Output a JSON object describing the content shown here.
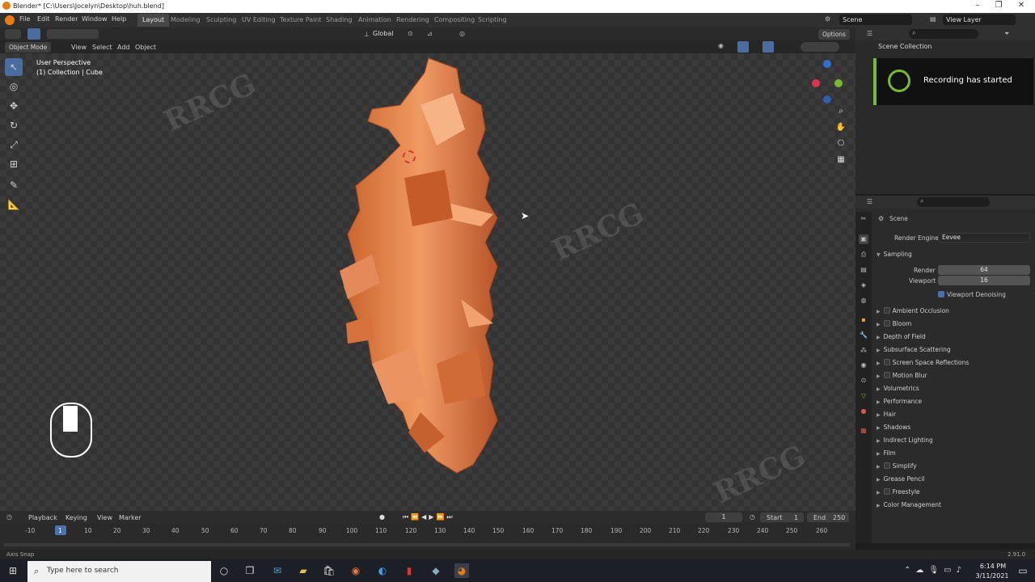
{
  "window": {
    "title": "Blender* [C:\\Users\\Jocelyn\\Desktop\\huh.blend]"
  },
  "menu": [
    "File",
    "Edit",
    "Render",
    "Window",
    "Help"
  ],
  "workspaces": [
    "Layout",
    "Modeling",
    "Sculpting",
    "UV Editing",
    "Texture Paint",
    "Shading",
    "Animation",
    "Rendering",
    "Compositing",
    "Scripting"
  ],
  "active_workspace": "Layout",
  "scene_field": "Scene",
  "view_layer_field": "View Layer",
  "header": {
    "transform_orientation": "Global",
    "options_label": "Options"
  },
  "viewport_header": {
    "mode": "Object Mode",
    "menu": [
      "View",
      "Select",
      "Add",
      "Object"
    ]
  },
  "viewport": {
    "perspective_label": "User Perspective",
    "collection_label": "(1) Collection | Cube",
    "watermark": "RRCG"
  },
  "outliner": {
    "scene_collection": "Scene Collection"
  },
  "notification": {
    "text": "Recording has started"
  },
  "properties": {
    "context": "Scene",
    "render_engine_label": "Render Engine",
    "render_engine": "Eevee",
    "sampling_label": "Sampling",
    "render_label": "Render",
    "render_value": "64",
    "viewport_label": "Viewport",
    "viewport_value": "16",
    "viewport_denoising": "Viewport Denoising",
    "panels": [
      "Ambient Occlusion",
      "Bloom",
      "Depth of Field",
      "Subsurface Scattering",
      "Screen Space Reflections",
      "Motion Blur",
      "Volumetrics",
      "Performance",
      "Hair",
      "Shadows",
      "Indirect Lighting",
      "Film",
      "Simplify",
      "Grease Pencil",
      "Freestyle",
      "Color Management"
    ]
  },
  "timeline": {
    "menu": [
      "Playback",
      "Keying",
      "View",
      "Marker"
    ],
    "current_frame": "1",
    "start_label": "Start",
    "start_value": "1",
    "end_label": "End",
    "end_value": "250",
    "ticks": [
      "-10",
      "1",
      "10",
      "20",
      "30",
      "40",
      "50",
      "60",
      "70",
      "80",
      "90",
      "100",
      "110",
      "120",
      "130",
      "140",
      "150",
      "160",
      "170",
      "180",
      "190",
      "200",
      "210",
      "220",
      "230",
      "240",
      "250",
      "260"
    ]
  },
  "status": {
    "left": "Axis Snap",
    "version": "2.91.0"
  },
  "taskbar": {
    "search_placeholder": "Type here to search",
    "time": "6:14 PM",
    "date": "3/11/2021"
  },
  "colors": {
    "accent": "#4b72b0",
    "model": "#e0804a",
    "blender_orange": "#e87d0d"
  }
}
